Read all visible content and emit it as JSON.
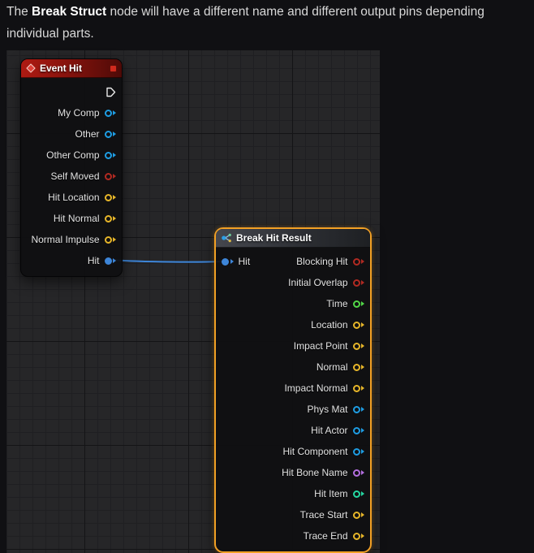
{
  "intro": {
    "line1_pre": "The ",
    "line1_bold": "Break Struct",
    "line1_post": " node will have a different name and different output pins depending",
    "line2": "individual parts."
  },
  "colors": {
    "exec": "#e8e8e8",
    "object": "#1e9de3",
    "bool": "#b22a22",
    "vector": "#e7b629",
    "float": "#52d948",
    "name": "#b46fe0",
    "int": "#25d8a2",
    "struct": "#3d85d8",
    "wire": "#3d85d8",
    "selection": "#f2a024",
    "delegate": "#d02a1e"
  },
  "event_node": {
    "title": "Event Hit",
    "pins": [
      {
        "label": "",
        "type": "exec"
      },
      {
        "label": "My Comp",
        "type": "object"
      },
      {
        "label": "Other",
        "type": "object"
      },
      {
        "label": "Other Comp",
        "type": "object"
      },
      {
        "label": "Self Moved",
        "type": "bool"
      },
      {
        "label": "Hit Location",
        "type": "vector"
      },
      {
        "label": "Hit Normal",
        "type": "vector"
      },
      {
        "label": "Normal Impulse",
        "type": "vector"
      },
      {
        "label": "Hit",
        "type": "struct",
        "connected": true
      }
    ]
  },
  "break_node": {
    "title": "Break Hit Result",
    "input": {
      "label": "Hit",
      "type": "struct",
      "connected": true
    },
    "outputs": [
      {
        "label": "Blocking Hit",
        "type": "bool"
      },
      {
        "label": "Initial Overlap",
        "type": "bool"
      },
      {
        "label": "Time",
        "type": "float"
      },
      {
        "label": "Location",
        "type": "vector"
      },
      {
        "label": "Impact Point",
        "type": "vector"
      },
      {
        "label": "Normal",
        "type": "vector"
      },
      {
        "label": "Impact Normal",
        "type": "vector"
      },
      {
        "label": "Phys Mat",
        "type": "object"
      },
      {
        "label": "Hit Actor",
        "type": "object"
      },
      {
        "label": "Hit Component",
        "type": "object"
      },
      {
        "label": "Hit Bone Name",
        "type": "name"
      },
      {
        "label": "Hit Item",
        "type": "int"
      },
      {
        "label": "Trace Start",
        "type": "vector"
      },
      {
        "label": "Trace End",
        "type": "vector"
      }
    ]
  }
}
